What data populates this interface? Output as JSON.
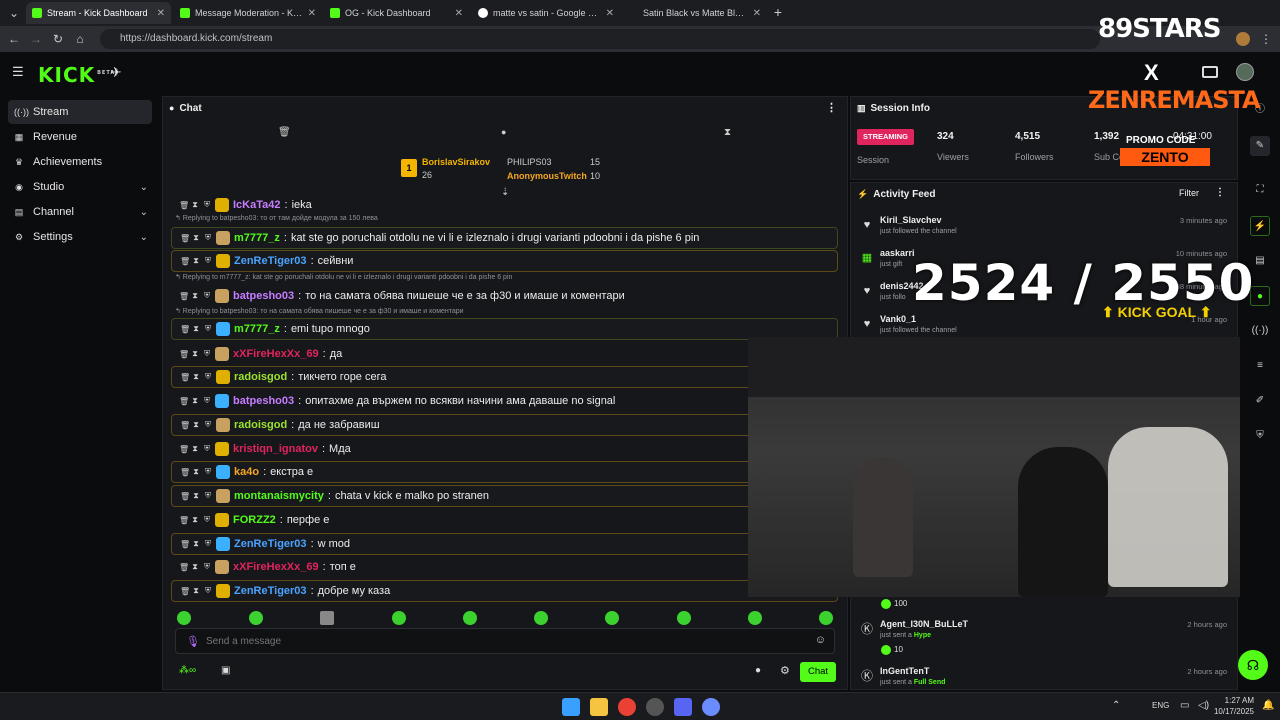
{
  "browser": {
    "tabs": [
      {
        "title": "Stream - Kick Dashboard",
        "active": true
      },
      {
        "title": "Message Moderation - Kick Dashb"
      },
      {
        "title": "OG - Kick Dashboard"
      },
      {
        "title": "matte vs satin - Google Търсене"
      },
      {
        "title": "Satin Black vs Matte Black Car W"
      }
    ],
    "new_tab": "+",
    "url": "https://dashboard.kick.com/stream"
  },
  "app": {
    "logo": "KICK",
    "logo_tag": "BETA"
  },
  "sidebar": {
    "items": [
      {
        "label": "Stream",
        "icon": "stream-icon"
      },
      {
        "label": "Revenue",
        "icon": "revenue-icon"
      },
      {
        "label": "Achievements",
        "icon": "trophy-icon"
      },
      {
        "label": "Studio",
        "icon": "studio-icon",
        "expandable": true
      },
      {
        "label": "Channel",
        "icon": "channel-icon",
        "expandable": true
      },
      {
        "label": "Settings",
        "icon": "gear-icon",
        "expandable": true
      }
    ]
  },
  "chat": {
    "title": "Chat",
    "leaderboard": {
      "first": {
        "name": "BorislavSirakov",
        "count": "26",
        "rank": "1"
      },
      "others": [
        {
          "name": "PHILIPS03",
          "count": "15"
        },
        {
          "name": "AnonymousTwitch",
          "count": "10"
        }
      ]
    },
    "messages": [
      {
        "user": "IcKaTa42",
        "text": "ieka",
        "color": "#c77dff"
      },
      {
        "reply": "Replying to batpesho03: то от там дойде модула за 150 лева"
      },
      {
        "user": "m7777_z",
        "text": "kat ste go poruchali otdolu ne vi li e izleznalo i drugi varianti pdoobni i da pishe 6 pin",
        "color": "#53fc18"
      },
      {
        "user": "ZenReTiger03",
        "text": "сейвни",
        "color": "#4aa3ff"
      },
      {
        "reply": "Replying to m7777_z: kat ste go poruchali otdolu ne vi li e izleznalo i drugi varianti pdoobni i da pishe 6 pin"
      },
      {
        "user": "batpesho03",
        "text": "то на самата обява пишеше че е за ф30 и имаше и коментари",
        "color": "#c77dff"
      },
      {
        "reply": "Replying to batpesho03: то на самата обява пишеше че е за ф30 и имаше и коментари"
      },
      {
        "user": "m7777_z",
        "text": "emi tupo mnogo",
        "color": "#53fc18"
      },
      {
        "user": "xXFireHexXx_69",
        "text": "да",
        "color": "#e0245e"
      },
      {
        "user": "radoisgod",
        "text": "тикчето горе сега",
        "color": "#9be22d"
      },
      {
        "user": "batpesho03",
        "text": "опитахме да вържем по всякви начини ама даваше no signal",
        "color": "#c77dff"
      },
      {
        "user": "radoisgod",
        "text": "да не забравиш",
        "color": "#9be22d"
      },
      {
        "user": "kristiqn_ignatov",
        "text": "Мда",
        "color": "#e0245e"
      },
      {
        "user": "ka4o",
        "text": "екстра е",
        "color": "#f5a623"
      },
      {
        "user": "montanaismycity",
        "text": "chata v kick e malko po stranen",
        "color": "#53fc18"
      },
      {
        "user": "FORZZ2",
        "text": "перфе е",
        "color": "#53fc18"
      },
      {
        "user": "ZenReTiger03",
        "text": "w mod",
        "color": "#4aa3ff"
      },
      {
        "user": "xXFireHexXx_69",
        "text": "топ е",
        "color": "#e0245e"
      },
      {
        "user": "ZenReTiger03",
        "text": "добре му каза",
        "color": "#4aa3ff"
      }
    ],
    "input_placeholder": "Send a message",
    "send_label": "Chat"
  },
  "session": {
    "title": "Session Info",
    "status": "STREAMING",
    "status_label": "Session",
    "viewers": "324",
    "viewers_label": "Viewers",
    "followers": "4,515",
    "followers_label": "Followers",
    "subs": "1,392",
    "subs_label": "Sub Co",
    "time": "04:31:00"
  },
  "activity": {
    "title": "Activity Feed",
    "filter": "Filter",
    "items": [
      {
        "name": "Kiril_Slavchev",
        "sub": "just followed the channel",
        "time": "3 minutes ago",
        "icon": "heart-icon"
      },
      {
        "name": "aaskarri",
        "sub": "just gift",
        "time": "10 minutes ago",
        "icon": "gift-icon"
      },
      {
        "name": "denis2442",
        "sub": "just follo",
        "time": "38 minutes ago",
        "icon": "heart-icon"
      },
      {
        "name": "Vank0_1",
        "sub": "just followed the channel",
        "time": "1 hour ago",
        "icon": "heart-icon"
      }
    ],
    "bottom": [
      {
        "name": "Agent_I30N_BuLLeT",
        "sub_prefix": "just sent a",
        "sub_bold": "Hype",
        "amount": "10",
        "time": "2 hours ago"
      },
      {
        "name": "InGentTenT",
        "sub_prefix": "just sent a",
        "sub_bold": "Full Send",
        "time": "2 hours ago"
      }
    ],
    "top_amount": "100"
  },
  "overlay": {
    "brand_top": "89STARS",
    "brand_x": "X",
    "brand_name": "ZENREMASTA",
    "promo": "PROMO CODE",
    "promo_code": "ZENTO",
    "goal": "2524 / 2550",
    "goal_label": "KICK GOAL"
  },
  "taskbar": {
    "lang": "ENG",
    "time": "1:27 AM",
    "date": "10/17/2025"
  }
}
